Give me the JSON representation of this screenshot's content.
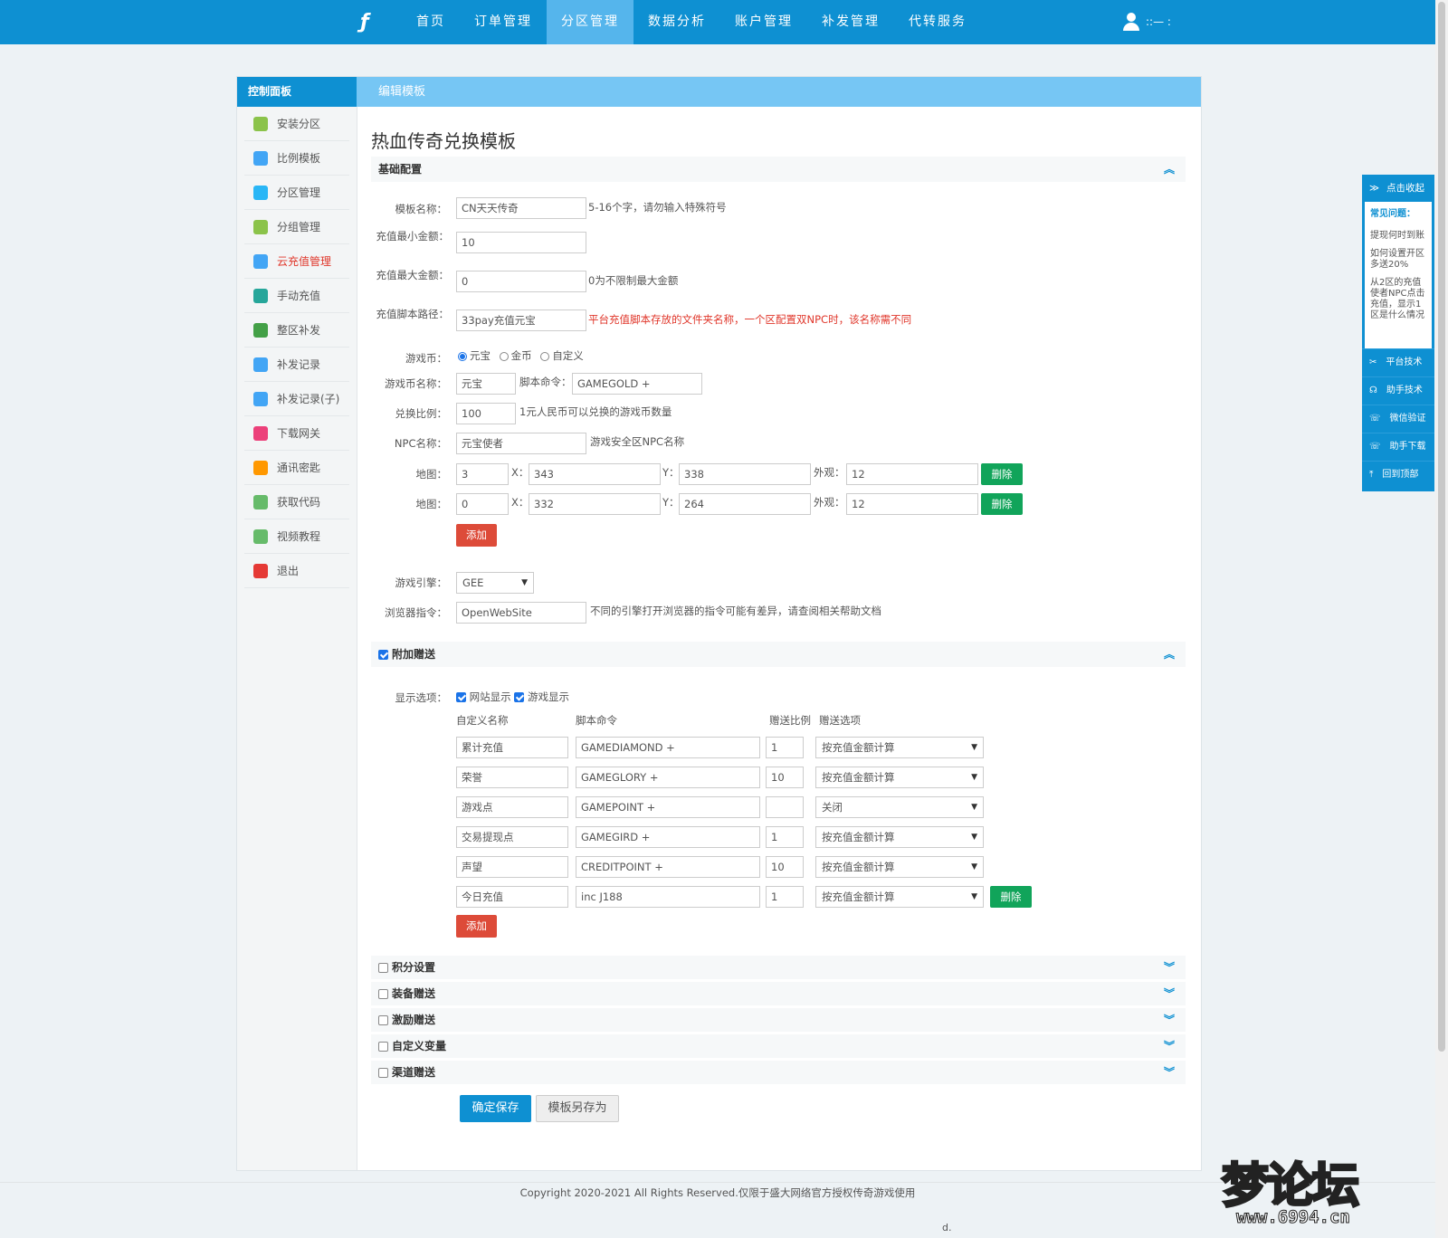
{
  "nav": {
    "logo": "ƒ",
    "items": [
      "首页",
      "订单管理",
      "分区管理",
      "数据分析",
      "账户管理",
      "补发管理",
      "代转服务"
    ],
    "user": "::— :"
  },
  "sidebar": {
    "title": "控制面板",
    "items": [
      {
        "label": "安装分区",
        "icon": "wrench-icon",
        "color": "#8bc34a"
      },
      {
        "label": "比例模板",
        "icon": "copy-icon",
        "color": "#42a5f5"
      },
      {
        "label": "分区管理",
        "icon": "inbox-icon",
        "color": "#29b6f6"
      },
      {
        "label": "分组管理",
        "icon": "users-icon",
        "color": "#8bc34a"
      },
      {
        "label": "云充值管理",
        "icon": "user-icon",
        "color": "#42a5f5"
      },
      {
        "label": "手动充值",
        "icon": "send-icon",
        "color": "#26a69a"
      },
      {
        "label": "整区补发",
        "icon": "calendar-icon",
        "color": "#43a047"
      },
      {
        "label": "补发记录",
        "icon": "copy-icon",
        "color": "#42a5f5"
      },
      {
        "label": "补发记录(子)",
        "icon": "copy-icon",
        "color": "#42a5f5"
      },
      {
        "label": "下载网关",
        "icon": "box-icon",
        "color": "#ec407a"
      },
      {
        "label": "通讯密匙",
        "icon": "key-icon",
        "color": "#ff9800"
      },
      {
        "label": "获取代码",
        "icon": "code-icon",
        "color": "#66bb6a"
      },
      {
        "label": "视频教程",
        "icon": "video-icon",
        "color": "#66bb6a"
      },
      {
        "label": "退出",
        "icon": "power-icon",
        "color": "#e53935"
      }
    ],
    "active_index": 4
  },
  "main": {
    "header": "编辑模板",
    "title": "热血传奇兑换模板",
    "basic": {
      "section": "基础配置",
      "name_label": "模板名称：",
      "name_value": "CN天天传奇",
      "name_hint": "5-16个字，请勿输入特殊符号",
      "min_label": "充值最小金额：",
      "min_value": "10",
      "max_label": "充值最大金额：",
      "max_value": "0",
      "max_hint": "0为不限制最大金额",
      "path_label": "充值脚本路径：",
      "path_value": "33pay充值元宝",
      "path_hint": "平台充值脚本存放的文件夹名称，一个区配置双NPC时，该名称需不同",
      "currency_label": "游戏币：",
      "currency_options": [
        "元宝",
        "金币",
        "自定义"
      ],
      "currency_selected": 0,
      "coin_name_label": "游戏币名称：",
      "coin_name_value": "元宝",
      "script_label": "脚本命令：",
      "script_value": "GAMEGOLD +",
      "ratio_label": "兑换比例：",
      "ratio_value": "100",
      "ratio_hint": "1元人民币可以兑换的游戏币数量",
      "npc_label": "NPC名称：",
      "npc_value": "元宝使者",
      "npc_hint": "游戏安全区NPC名称",
      "map_label": "地图：",
      "x_label": "X：",
      "y_label": "Y：",
      "look_label": "外观：",
      "maps": [
        {
          "map": "3",
          "x": "343",
          "y": "338",
          "look": "12"
        },
        {
          "map": "0",
          "x": "332",
          "y": "264",
          "look": "12"
        }
      ],
      "delete_label": "删除",
      "add_label": "添加",
      "engine_label": "游戏引擎：",
      "engine_value": "GEE",
      "browser_label": "浏览器指令：",
      "browser_value": "OpenWebSite",
      "browser_hint": "不同的引擎打开浏览器的指令可能有差异，请查阅相关帮助文档"
    },
    "bonus": {
      "section": "附加赠送",
      "display_label": "显示选项：",
      "display_web": "网站显示",
      "display_game": "游戏显示",
      "col_name": "自定义名称",
      "col_script": "脚本命令",
      "col_ratio": "赠送比例",
      "col_option": "赠送选项",
      "rows": [
        {
          "name": "累计充值",
          "script": "GAMEDIAMOND +",
          "ratio": "1",
          "option": "按充值金额计算"
        },
        {
          "name": "荣誉",
          "script": "GAMEGLORY +",
          "ratio": "10",
          "option": "按充值金额计算"
        },
        {
          "name": "游戏点",
          "script": "GAMEPOINT +",
          "ratio": "",
          "option": "关闭"
        },
        {
          "name": "交易提现点",
          "script": "GAMEGIRD +",
          "ratio": "1",
          "option": "按充值金额计算"
        },
        {
          "name": "声望",
          "script": "CREDITPOINT +",
          "ratio": "10",
          "option": "按充值金额计算"
        },
        {
          "name": "今日充值",
          "script": "inc J188",
          "ratio": "1",
          "option": "按充值金额计算"
        }
      ],
      "delete_label": "删除",
      "add_label": "添加"
    },
    "collapsed_sections": [
      "积分设置",
      "装备赠送",
      "激励赠送",
      "自定义变量",
      "渠道赠送"
    ],
    "save_label": "确定保存",
    "save_as_label": "模板另存为"
  },
  "footer": {
    "copyright": "Copyright 2020-2021 All Rights Reserved.仅限于盛大网络官方授权传奇游戏使用",
    "mark": "d."
  },
  "right_bar": {
    "collapse": "点击收起",
    "faq_title": "常见问题：",
    "faq": [
      "提现何时到账",
      "如何设置开区多送20%",
      "从2区的充值使者NPC点击充值，显示1区是什么情况"
    ],
    "items": [
      "平台技术",
      "助手技术",
      "微信验证",
      "助手下载",
      "回到顶部"
    ]
  },
  "watermark": {
    "text": "梦论坛",
    "url": "www.6994.cn"
  }
}
